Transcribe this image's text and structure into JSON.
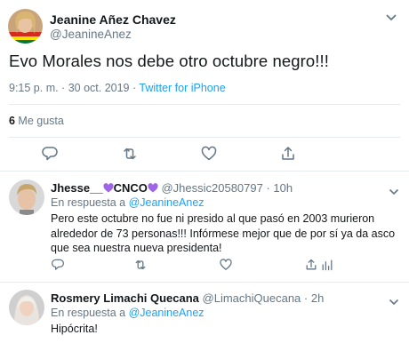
{
  "main_tweet": {
    "author_name": "Jeanine Añez Chavez",
    "author_handle": "@JeanineAnez",
    "text": "Evo Morales nos debe otro octubre negro!!!",
    "time": "9:15 p. m. · 30 oct. 2019 · ",
    "source": "Twitter for iPhone",
    "likes_count": "6",
    "likes_label": " Me gusta",
    "icons": [
      "reply-icon",
      "retweet-icon",
      "like-icon",
      "share-icon"
    ]
  },
  "replies": [
    {
      "name_prefix": "Jhesse__",
      "name_suffix": "CNCO",
      "handle_time": "@Jhessic20580797 · 10h",
      "replying_prefix": "En respuesta a ",
      "replying_to": "@JeanineAnez",
      "text": "Pero este octubre no fue ni presido al que pasó en 2003 murieron alrededor de 73 personas!!! Infórmese mejor que de por sí ya da asco que sea nuestra nueva presidenta!",
      "icons": [
        "reply-icon",
        "retweet-icon",
        "like-icon",
        "share-icon",
        "chart-icon"
      ]
    },
    {
      "name": "Rosmery Limachi Quecana",
      "handle_time": "@LimachiQuecana · 2h",
      "replying_prefix": "En respuesta a ",
      "replying_to": "@JeanineAnez",
      "text": "Hipócrita!"
    }
  ],
  "colors": {
    "link": "#1da1f2",
    "secondary_text": "#657786",
    "divider": "#e6ecf0",
    "heart_purple": "#a064e6"
  }
}
